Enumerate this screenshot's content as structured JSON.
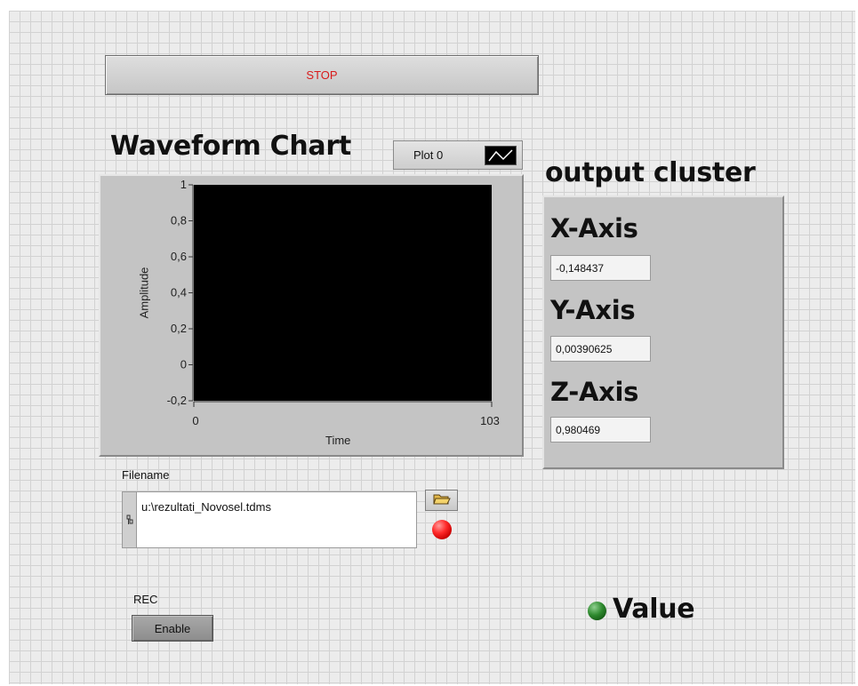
{
  "stop_button": {
    "label": "STOP"
  },
  "waveform_chart": {
    "title": "Waveform Chart",
    "legend": {
      "plot_name": "Plot 0"
    }
  },
  "chart_data": {
    "type": "line",
    "title": "Waveform Chart",
    "xlabel": "Time",
    "ylabel": "Amplitude",
    "xlim": [
      0,
      103
    ],
    "ylim": [
      -0.2,
      1
    ],
    "x_tick_labels": [
      "0",
      "103"
    ],
    "y_tick_labels": [
      "1",
      "0,8",
      "0,6",
      "0,4",
      "0,2",
      "0",
      "-0,2"
    ],
    "y_tick_values": [
      1,
      0.8,
      0.6,
      0.4,
      0.2,
      0,
      -0.2
    ],
    "series": [
      {
        "name": "Plot 0",
        "x": [],
        "y": []
      }
    ],
    "plot_background": "#000000",
    "grid": false
  },
  "output_cluster": {
    "title": "output cluster",
    "fields": [
      {
        "label": "X-Axis",
        "value": "-0,148437"
      },
      {
        "label": "Y-Axis",
        "value": "0,00390625"
      },
      {
        "label": "Z-Axis",
        "value": "0,980469"
      }
    ]
  },
  "filename": {
    "label": "Filename",
    "path": "u:\\rezultati_Novosel.tdms",
    "grip_icon": "path-grip-icon",
    "browse_icon": "folder-open-icon"
  },
  "status_led": {
    "color": "#e00000"
  },
  "rec": {
    "label": "REC",
    "button_label": "Enable"
  },
  "value_indicator": {
    "label": "Value",
    "color": "#1f7a1f"
  }
}
